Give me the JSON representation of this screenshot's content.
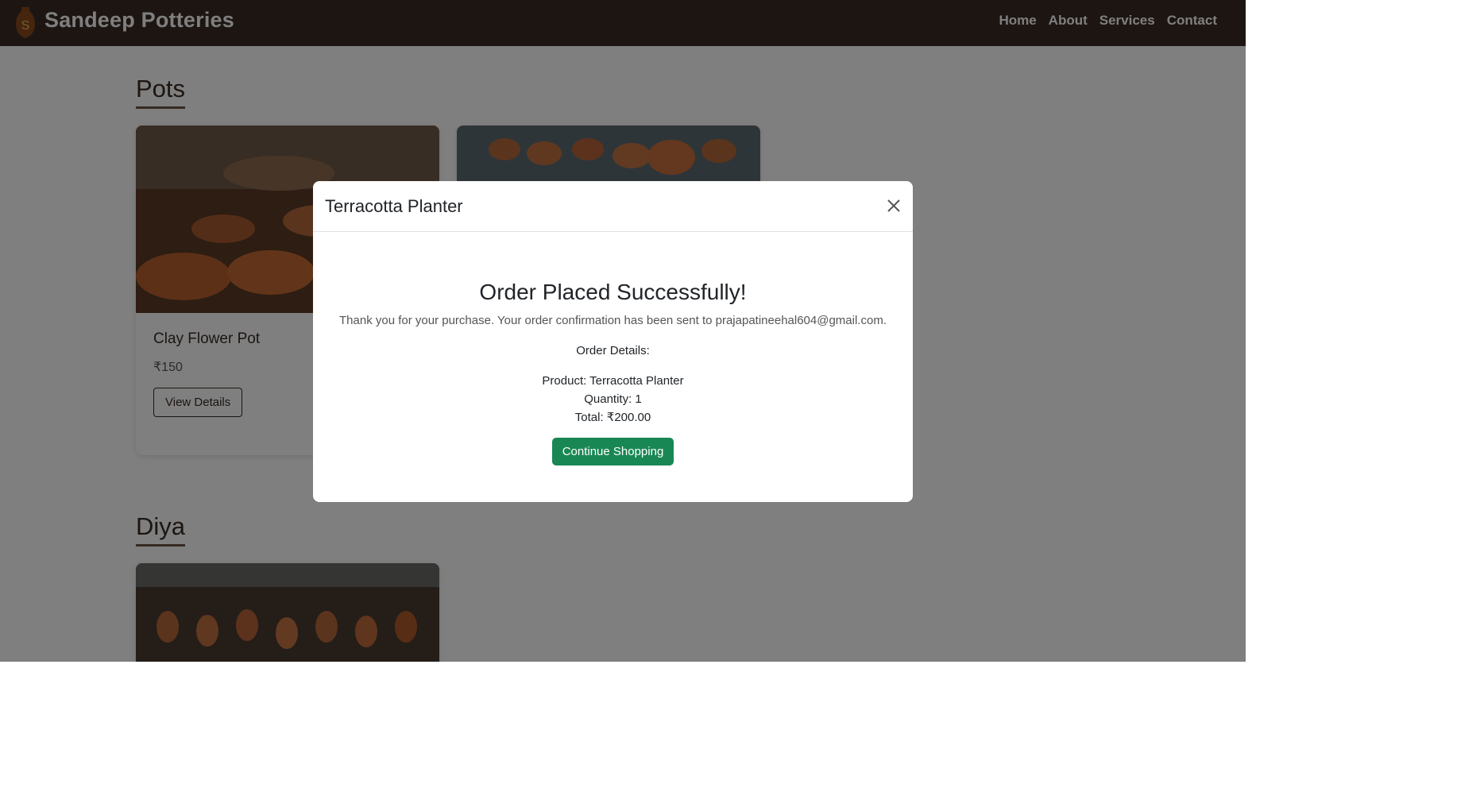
{
  "navbar": {
    "brand": "Sandeep Potteries",
    "links": [
      "Home",
      "About",
      "Services",
      "Contact"
    ]
  },
  "sections": [
    {
      "title": "Pots",
      "cards": [
        {
          "title": "Clay Flower Pot",
          "price": "₹150",
          "button": "View Details"
        }
      ]
    },
    {
      "title": "Diya"
    }
  ],
  "modal": {
    "title": "Terracotta Planter",
    "heading": "Order Placed Successfully!",
    "message": "Thank you for your purchase. Your order confirmation has been sent to prajapatineehal604@gmail.com.",
    "details_label": "Order Details:",
    "product": "Product: Terracotta Planter",
    "quantity": "Quantity: 1",
    "total": "Total: ₹200.00",
    "button": "Continue Shopping"
  },
  "colors": {
    "navbar": "#3b2b22",
    "success": "#198754"
  },
  "icons": [
    "logo-icon",
    "close-icon"
  ]
}
